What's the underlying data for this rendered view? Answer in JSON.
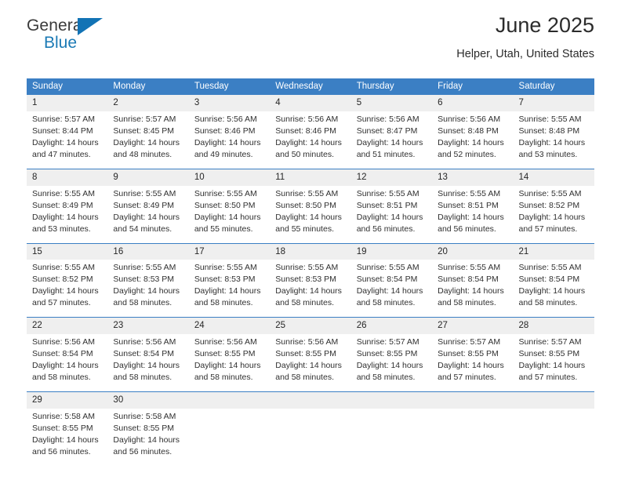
{
  "brand": {
    "name_part1": "General",
    "name_part2": "Blue",
    "flag_icon": "triangle-flag-icon"
  },
  "header": {
    "month_title": "June 2025",
    "location": "Helper, Utah, United States"
  },
  "colors": {
    "header_blue": "#3b7fc4",
    "daynum_bg": "#efefef",
    "brand_blue": "#1b7ab5",
    "text": "#303030"
  },
  "calendar": {
    "weekday_headers": [
      "Sunday",
      "Monday",
      "Tuesday",
      "Wednesday",
      "Thursday",
      "Friday",
      "Saturday"
    ],
    "weeks": [
      [
        {
          "day": "1",
          "sunrise": "Sunrise: 5:57 AM",
          "sunset": "Sunset: 8:44 PM",
          "daylight1": "Daylight: 14 hours",
          "daylight2": "and 47 minutes."
        },
        {
          "day": "2",
          "sunrise": "Sunrise: 5:57 AM",
          "sunset": "Sunset: 8:45 PM",
          "daylight1": "Daylight: 14 hours",
          "daylight2": "and 48 minutes."
        },
        {
          "day": "3",
          "sunrise": "Sunrise: 5:56 AM",
          "sunset": "Sunset: 8:46 PM",
          "daylight1": "Daylight: 14 hours",
          "daylight2": "and 49 minutes."
        },
        {
          "day": "4",
          "sunrise": "Sunrise: 5:56 AM",
          "sunset": "Sunset: 8:46 PM",
          "daylight1": "Daylight: 14 hours",
          "daylight2": "and 50 minutes."
        },
        {
          "day": "5",
          "sunrise": "Sunrise: 5:56 AM",
          "sunset": "Sunset: 8:47 PM",
          "daylight1": "Daylight: 14 hours",
          "daylight2": "and 51 minutes."
        },
        {
          "day": "6",
          "sunrise": "Sunrise: 5:56 AM",
          "sunset": "Sunset: 8:48 PM",
          "daylight1": "Daylight: 14 hours",
          "daylight2": "and 52 minutes."
        },
        {
          "day": "7",
          "sunrise": "Sunrise: 5:55 AM",
          "sunset": "Sunset: 8:48 PM",
          "daylight1": "Daylight: 14 hours",
          "daylight2": "and 53 minutes."
        }
      ],
      [
        {
          "day": "8",
          "sunrise": "Sunrise: 5:55 AM",
          "sunset": "Sunset: 8:49 PM",
          "daylight1": "Daylight: 14 hours",
          "daylight2": "and 53 minutes."
        },
        {
          "day": "9",
          "sunrise": "Sunrise: 5:55 AM",
          "sunset": "Sunset: 8:49 PM",
          "daylight1": "Daylight: 14 hours",
          "daylight2": "and 54 minutes."
        },
        {
          "day": "10",
          "sunrise": "Sunrise: 5:55 AM",
          "sunset": "Sunset: 8:50 PM",
          "daylight1": "Daylight: 14 hours",
          "daylight2": "and 55 minutes."
        },
        {
          "day": "11",
          "sunrise": "Sunrise: 5:55 AM",
          "sunset": "Sunset: 8:50 PM",
          "daylight1": "Daylight: 14 hours",
          "daylight2": "and 55 minutes."
        },
        {
          "day": "12",
          "sunrise": "Sunrise: 5:55 AM",
          "sunset": "Sunset: 8:51 PM",
          "daylight1": "Daylight: 14 hours",
          "daylight2": "and 56 minutes."
        },
        {
          "day": "13",
          "sunrise": "Sunrise: 5:55 AM",
          "sunset": "Sunset: 8:51 PM",
          "daylight1": "Daylight: 14 hours",
          "daylight2": "and 56 minutes."
        },
        {
          "day": "14",
          "sunrise": "Sunrise: 5:55 AM",
          "sunset": "Sunset: 8:52 PM",
          "daylight1": "Daylight: 14 hours",
          "daylight2": "and 57 minutes."
        }
      ],
      [
        {
          "day": "15",
          "sunrise": "Sunrise: 5:55 AM",
          "sunset": "Sunset: 8:52 PM",
          "daylight1": "Daylight: 14 hours",
          "daylight2": "and 57 minutes."
        },
        {
          "day": "16",
          "sunrise": "Sunrise: 5:55 AM",
          "sunset": "Sunset: 8:53 PM",
          "daylight1": "Daylight: 14 hours",
          "daylight2": "and 58 minutes."
        },
        {
          "day": "17",
          "sunrise": "Sunrise: 5:55 AM",
          "sunset": "Sunset: 8:53 PM",
          "daylight1": "Daylight: 14 hours",
          "daylight2": "and 58 minutes."
        },
        {
          "day": "18",
          "sunrise": "Sunrise: 5:55 AM",
          "sunset": "Sunset: 8:53 PM",
          "daylight1": "Daylight: 14 hours",
          "daylight2": "and 58 minutes."
        },
        {
          "day": "19",
          "sunrise": "Sunrise: 5:55 AM",
          "sunset": "Sunset: 8:54 PM",
          "daylight1": "Daylight: 14 hours",
          "daylight2": "and 58 minutes."
        },
        {
          "day": "20",
          "sunrise": "Sunrise: 5:55 AM",
          "sunset": "Sunset: 8:54 PM",
          "daylight1": "Daylight: 14 hours",
          "daylight2": "and 58 minutes."
        },
        {
          "day": "21",
          "sunrise": "Sunrise: 5:55 AM",
          "sunset": "Sunset: 8:54 PM",
          "daylight1": "Daylight: 14 hours",
          "daylight2": "and 58 minutes."
        }
      ],
      [
        {
          "day": "22",
          "sunrise": "Sunrise: 5:56 AM",
          "sunset": "Sunset: 8:54 PM",
          "daylight1": "Daylight: 14 hours",
          "daylight2": "and 58 minutes."
        },
        {
          "day": "23",
          "sunrise": "Sunrise: 5:56 AM",
          "sunset": "Sunset: 8:54 PM",
          "daylight1": "Daylight: 14 hours",
          "daylight2": "and 58 minutes."
        },
        {
          "day": "24",
          "sunrise": "Sunrise: 5:56 AM",
          "sunset": "Sunset: 8:55 PM",
          "daylight1": "Daylight: 14 hours",
          "daylight2": "and 58 minutes."
        },
        {
          "day": "25",
          "sunrise": "Sunrise: 5:56 AM",
          "sunset": "Sunset: 8:55 PM",
          "daylight1": "Daylight: 14 hours",
          "daylight2": "and 58 minutes."
        },
        {
          "day": "26",
          "sunrise": "Sunrise: 5:57 AM",
          "sunset": "Sunset: 8:55 PM",
          "daylight1": "Daylight: 14 hours",
          "daylight2": "and 58 minutes."
        },
        {
          "day": "27",
          "sunrise": "Sunrise: 5:57 AM",
          "sunset": "Sunset: 8:55 PM",
          "daylight1": "Daylight: 14 hours",
          "daylight2": "and 57 minutes."
        },
        {
          "day": "28",
          "sunrise": "Sunrise: 5:57 AM",
          "sunset": "Sunset: 8:55 PM",
          "daylight1": "Daylight: 14 hours",
          "daylight2": "and 57 minutes."
        }
      ],
      [
        {
          "day": "29",
          "sunrise": "Sunrise: 5:58 AM",
          "sunset": "Sunset: 8:55 PM",
          "daylight1": "Daylight: 14 hours",
          "daylight2": "and 56 minutes."
        },
        {
          "day": "30",
          "sunrise": "Sunrise: 5:58 AM",
          "sunset": "Sunset: 8:55 PM",
          "daylight1": "Daylight: 14 hours",
          "daylight2": "and 56 minutes."
        },
        {
          "day": "",
          "sunrise": "",
          "sunset": "",
          "daylight1": "",
          "daylight2": ""
        },
        {
          "day": "",
          "sunrise": "",
          "sunset": "",
          "daylight1": "",
          "daylight2": ""
        },
        {
          "day": "",
          "sunrise": "",
          "sunset": "",
          "daylight1": "",
          "daylight2": ""
        },
        {
          "day": "",
          "sunrise": "",
          "sunset": "",
          "daylight1": "",
          "daylight2": ""
        },
        {
          "day": "",
          "sunrise": "",
          "sunset": "",
          "daylight1": "",
          "daylight2": ""
        }
      ]
    ]
  }
}
